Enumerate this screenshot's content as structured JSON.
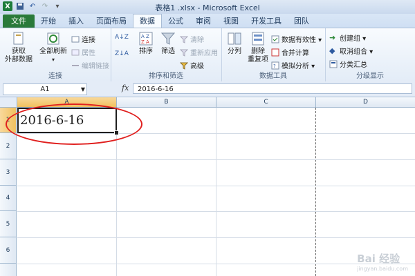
{
  "window": {
    "title": "表格1 .xlsx - Microsoft Excel"
  },
  "tabs": [
    "文件",
    "开始",
    "插入",
    "页面布局",
    "数据",
    "公式",
    "审阅",
    "视图",
    "开发工具",
    "团队"
  ],
  "ribbon": {
    "connections": {
      "get_external": "获取\n外部数据",
      "refresh_all": "全部刷新",
      "connections": "连接",
      "properties": "属性",
      "edit_links": "编辑链接",
      "label": "连接"
    },
    "sort_filter": {
      "sort_az": "A↓Z",
      "sort_za": "Z↓A",
      "sort": "排序",
      "filter": "筛选",
      "clear": "清除",
      "reapply": "重新应用",
      "advanced": "高级",
      "label": "排序和筛选"
    },
    "data_tools": {
      "text_to_columns": "分列",
      "remove_duplicates": "删除\n重复项",
      "data_validation": "数据有效性 ▾",
      "consolidate": "合并计算",
      "what_if": "模拟分析 ▾",
      "label": "数据工具"
    },
    "outline": {
      "group": "创建组 ▾",
      "ungroup": "取消组合 ▾",
      "subtotal": "分类汇总",
      "label": "分级显示"
    }
  },
  "formula_bar": {
    "name_box": "A1",
    "fx": "fx",
    "value": "2016-6-16"
  },
  "sheet": {
    "columns": [
      "A",
      "B",
      "C",
      "D"
    ],
    "rows": [
      "1",
      "2",
      "3",
      "4",
      "5",
      "6"
    ],
    "a1_value": "2016-6-16",
    "selected_column": "A",
    "selected_row": "1"
  },
  "watermark": {
    "brand": "Bai 经验",
    "url": "jingyan.baidu.com"
  },
  "colors": {
    "file_tab": "#2a7a3a",
    "highlight_ellipse": "#e0201f",
    "selection": "#f1c15f"
  }
}
